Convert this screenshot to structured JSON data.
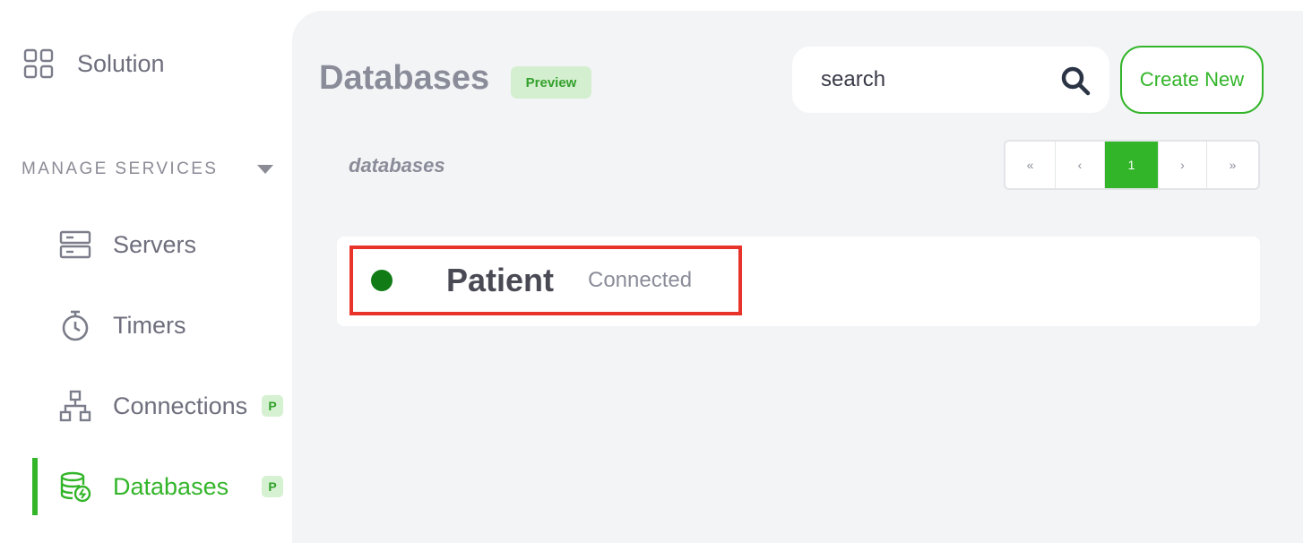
{
  "sidebar": {
    "solution_label": "Solution",
    "section_title": "MANAGE SERVICES",
    "items": [
      {
        "label": "Servers",
        "icon": "server-icon"
      },
      {
        "label": "Timers",
        "icon": "timer-icon"
      },
      {
        "label": "Connections",
        "icon": "connections-icon",
        "badge": "P"
      },
      {
        "label": "Databases",
        "icon": "database-icon",
        "badge": "P",
        "active": true
      }
    ]
  },
  "main": {
    "title": "Databases",
    "title_badge": "Preview",
    "search": {
      "placeholder": "search"
    },
    "create_label": "Create New",
    "list_label": "databases",
    "pagination": {
      "first": "«",
      "prev": "‹",
      "current": "1",
      "next": "›",
      "last": "»"
    },
    "databases": [
      {
        "name": "Patient",
        "status": "Connected"
      }
    ]
  },
  "colors": {
    "accent": "#33b52a",
    "status_connected": "#117c16",
    "highlight": "#e8332a",
    "main_bg": "#f3f4f6"
  }
}
